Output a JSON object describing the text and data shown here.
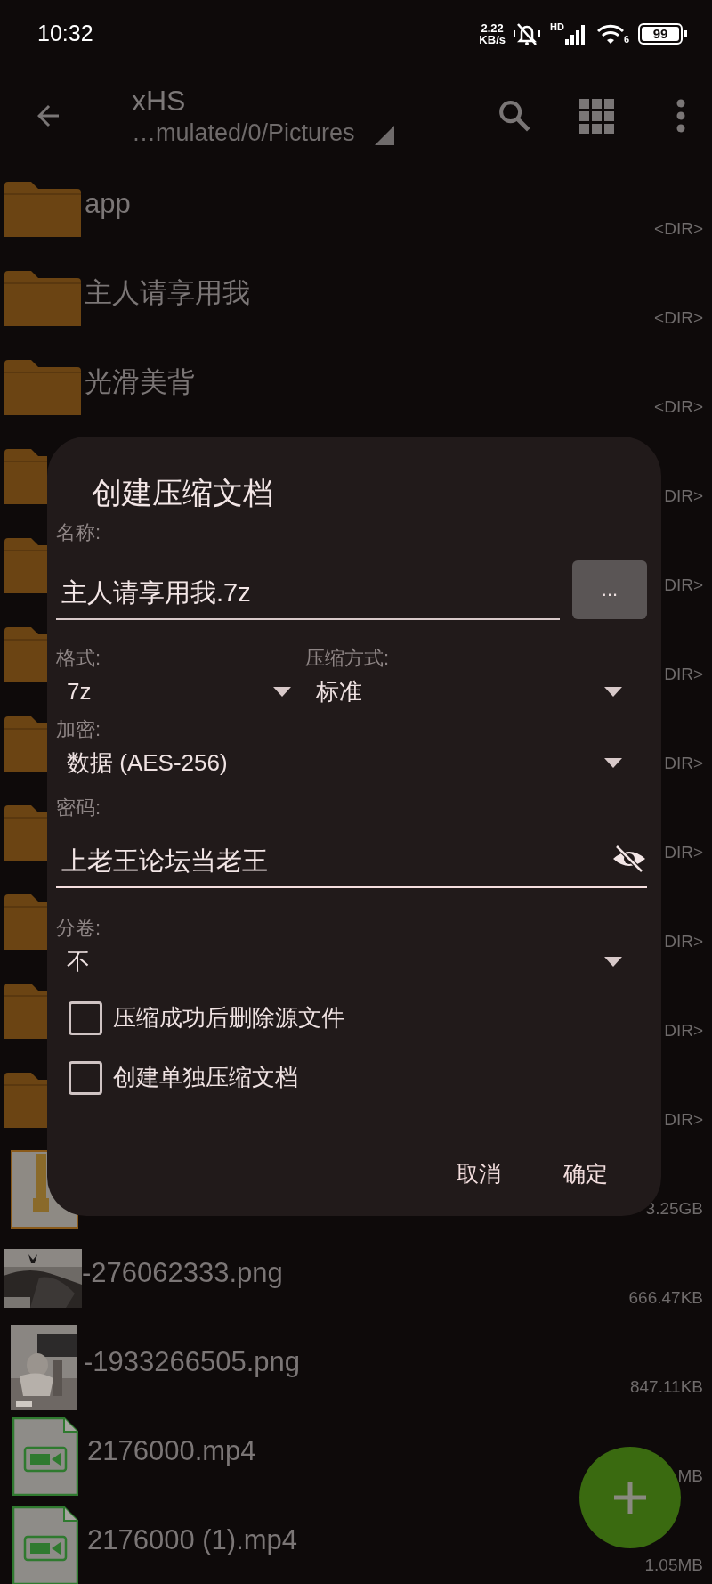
{
  "status_bar": {
    "time": "10:32",
    "speed": [
      "2.22",
      "KB/s"
    ],
    "signal_label": "HD",
    "wifi_label": "6",
    "battery": "99"
  },
  "toolbar": {
    "title": "xHS",
    "path": "…mulated/0/Pictures"
  },
  "files": [
    {
      "kind": "folder",
      "name": "app",
      "size": "<DIR>"
    },
    {
      "kind": "folder",
      "name": "主人请享用我",
      "size": "<DIR>"
    },
    {
      "kind": "folder",
      "name": "光滑美背",
      "size": "<DIR>"
    },
    {
      "kind": "folder",
      "size": "DIR>"
    },
    {
      "kind": "folder",
      "size": "DIR>"
    },
    {
      "kind": "folder",
      "size": "DIR>"
    },
    {
      "kind": "folder",
      "size": "DIR>"
    },
    {
      "kind": "folder",
      "size": "DIR>"
    },
    {
      "kind": "folder",
      "size": "DIR>"
    },
    {
      "kind": "folder",
      "size": "DIR>"
    },
    {
      "kind": "folder",
      "size": "DIR>"
    },
    {
      "kind": "archive",
      "size": "3.25GB"
    },
    {
      "name": "-276062333.png",
      "size": "666.47KB"
    },
    {
      "name": "-1933266505.png",
      "size": "847.11KB"
    },
    {
      "kind": "video",
      "name": "2176000.mp4",
      "size": "MB"
    },
    {
      "kind": "video",
      "name": "2176000 (1).mp4",
      "size": "1.05MB"
    }
  ],
  "dialog": {
    "title": "创建压缩文档",
    "name_field": {
      "label": "名称:",
      "value": "主人请享用我.7z",
      "browse_button": "..."
    },
    "format": {
      "label": "格式:",
      "value": "7z"
    },
    "method": {
      "label": "压缩方式:",
      "value": "标准"
    },
    "encryption": {
      "label": "加密:",
      "value": "数据 (AES-256)"
    },
    "password": {
      "label": "密码:",
      "value": "上老王论坛当老王",
      "visible": true
    },
    "split": {
      "label": "分卷:",
      "value": "不"
    },
    "checkboxes": [
      {
        "label": "压缩成功后删除源文件",
        "checked": false
      },
      {
        "label": "创建单独压缩文档",
        "checked": false
      }
    ],
    "buttons": [
      "取消",
      "确定"
    ]
  }
}
